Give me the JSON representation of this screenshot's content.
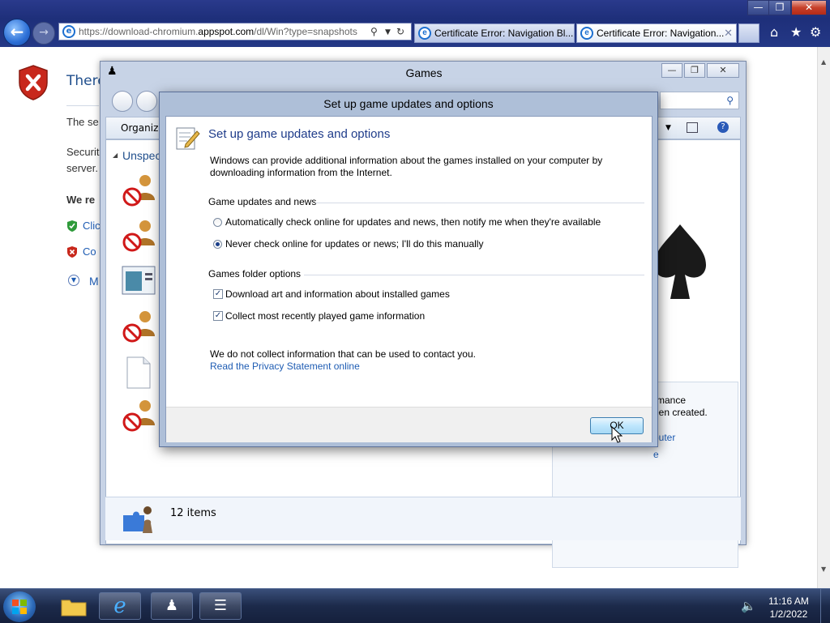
{
  "browser": {
    "url_prefix": "https://download-chromium.",
    "url_domain": "appspot.com",
    "url_suffix": "/dl/Win?type=snapshots",
    "tabs": [
      {
        "label": "Certificate Error: Navigation Bl..."
      },
      {
        "label": "Certificate Error: Navigation..."
      }
    ],
    "window_controls": {
      "minimize": "—",
      "maximize": "❐",
      "close": "✕"
    }
  },
  "cert_page": {
    "title": "There",
    "line1": "The se",
    "line2a": "Securit",
    "line2b": "server.",
    "recommend": "We re",
    "link1": "Clic",
    "link2": "Co",
    "more": "M"
  },
  "games_window": {
    "title": "Games",
    "toolbar_organize": "Organize",
    "group_label": "Unspec",
    "status_count": "12 items",
    "details_text1": "rmance",
    "details_text2": "een created.",
    "details_link1": "puter",
    "details_link2": "e"
  },
  "dialog": {
    "title": "Set up game updates and options",
    "heading": "Set up game updates and options",
    "description": "Windows can provide additional information about the games installed on your computer by downloading information from the Internet.",
    "section1_label": "Game updates and news",
    "radio_auto": "Automatically check online for updates and news, then notify me when they're available",
    "radio_never": "Never check online for updates or news; I'll do this manually",
    "radio_selected": "never",
    "section2_label": "Games folder options",
    "check_download_art": "Download art and information about installed games",
    "check_download_art_checked": true,
    "check_recent": "Collect most recently played game information",
    "check_recent_checked": true,
    "privacy_note": "We do not collect information that can be used to contact you.",
    "privacy_link": "Read the Privacy Statement online",
    "ok_label": "OK"
  },
  "taskbar": {
    "time": "11:16 AM",
    "date": "1/2/2022"
  }
}
